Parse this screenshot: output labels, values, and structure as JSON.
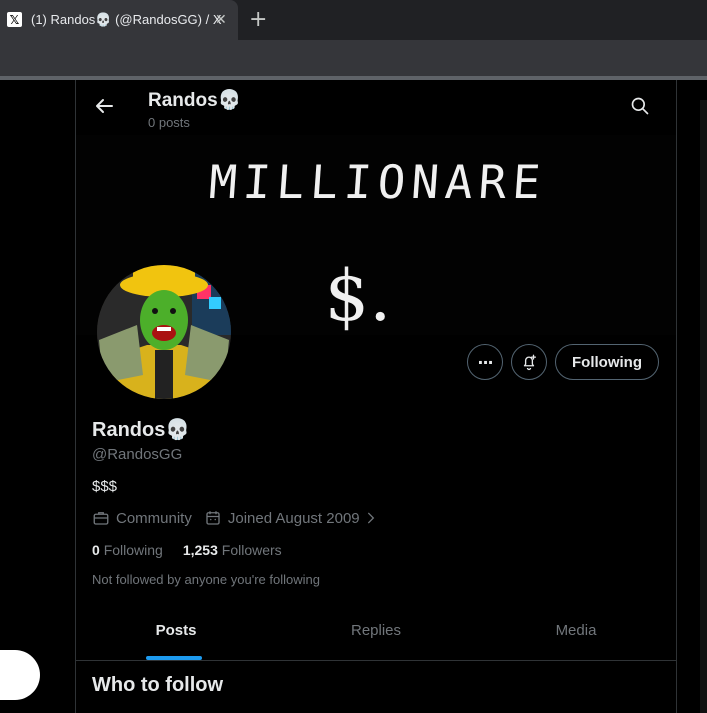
{
  "browser": {
    "tab_title": "(1) Randos💀 (@RandosGG) / X",
    "favicon_glyph": "𝕏",
    "close_glyph": "✕",
    "new_tab_glyph": "+"
  },
  "header": {
    "name": "Randos",
    "skull": "💀",
    "posts_count": "0 posts"
  },
  "banner": {
    "text": "MILLIONARE",
    "symbol": "$."
  },
  "actions": {
    "more_glyph": "···",
    "follow_label": "Following"
  },
  "profile": {
    "name": "Randos",
    "skull": "💀",
    "handle": "@RandosGG",
    "bio": "$$$",
    "category": "Community",
    "joined": "Joined August 2009",
    "following_count": "0",
    "following_label": "Following",
    "followers_count": "1,253",
    "followers_label": "Followers",
    "not_followed_text": "Not followed by anyone you're following"
  },
  "tabs": [
    {
      "label": "Posts"
    },
    {
      "label": "Replies"
    },
    {
      "label": "Media"
    }
  ],
  "who_to_follow": "Who to follow",
  "colors": {
    "background": "#000000",
    "accent": "#1d9bf0",
    "muted_text": "#71767b",
    "border": "#2f3336"
  }
}
